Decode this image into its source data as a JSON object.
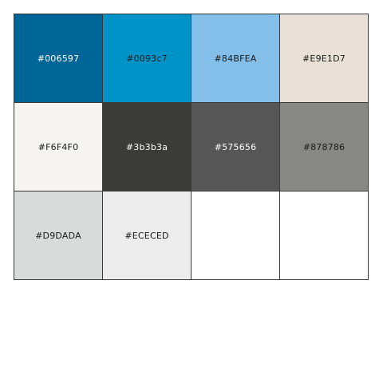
{
  "palette": {
    "swatches": [
      {
        "label": "#006597",
        "color": "#006597",
        "text_color": "#ffffff"
      },
      {
        "label": "#0093c7",
        "color": "#0093c7",
        "text_color": "#1a1a1a"
      },
      {
        "label": "#84BFEA",
        "color": "#84BFEA",
        "text_color": "#1a1a1a"
      },
      {
        "label": "#E9E1D7",
        "color": "#E9E1D7",
        "text_color": "#1a1a1a"
      },
      {
        "label": "#F6F4F0",
        "color": "#F6F4F0",
        "text_color": "#1a1a1a"
      },
      {
        "label": "#3b3b3a",
        "color": "#3b3b3a",
        "text_color": "#ffffff"
      },
      {
        "label": "#575656",
        "color": "#575656",
        "text_color": "#ffffff"
      },
      {
        "label": "#878786",
        "color": "#878786",
        "text_color": "#1a1a1a"
      },
      {
        "label": "#D9DADA",
        "color": "#D9DADA",
        "text_color": "#1a1a1a"
      },
      {
        "label": "#ECECED",
        "color": "#ECECED",
        "text_color": "#1a1a1a"
      },
      {
        "label": "",
        "color": "#ffffff",
        "text_color": "#1a1a1a"
      },
      {
        "label": "",
        "color": "#ffffff",
        "text_color": "#1a1a1a"
      }
    ]
  }
}
